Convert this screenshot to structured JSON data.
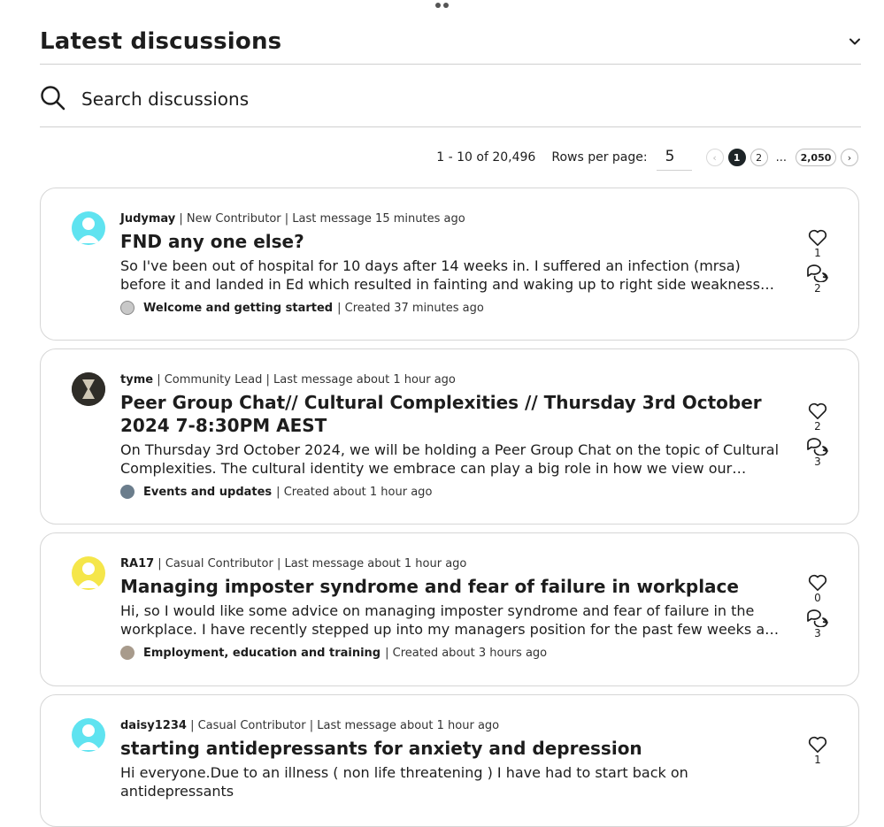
{
  "header": {
    "title": "Latest discussions"
  },
  "search": {
    "placeholder": "Search discussions"
  },
  "pagination": {
    "range": "1 - 10 of 20,496",
    "rows_label": "Rows per page:",
    "rows_value": "5",
    "pages": [
      "1",
      "2"
    ],
    "ellipsis": "...",
    "last_page": "2,050",
    "prev_icon": "‹",
    "next_icon": "›"
  },
  "discussions": [
    {
      "author": "Judymay",
      "role": "New Contributor",
      "last_message": "Last message 15 minutes ago",
      "title": "FND any one else?",
      "excerpt": "So I've been out of hospital for 10 days after 14 weeks in. I suffered an infection (mrsa) before it and landed in Ed which resulted in fainting and waking up to right side weakness and loss of sensation...",
      "board": "Welcome and getting started",
      "created": "Created 37 minutes ago",
      "likes": "1",
      "replies": "2",
      "avatar_color": "#5fe3f0"
    },
    {
      "author": "tyme",
      "role": "Community Lead",
      "last_message": "Last message about 1 hour ago",
      "title": "Peer Group Chat// Cultural Complexities // Thursday 3rd October 2024 7-8:30PM AEST",
      "excerpt": "On Thursday 3rd October 2024, we will be holding a Peer Group Chat on the topic of Cultural Complexities. The cultural identity we embrace can play a big role in how we view our mental health...",
      "board": "Events and updates",
      "created": "Created about 1 hour ago",
      "likes": "2",
      "replies": "3",
      "avatar_color": "#3a3a32"
    },
    {
      "author": "RA17",
      "role": "Casual Contributor",
      "last_message": "Last message about 1 hour ago",
      "title": "Managing imposter syndrome and fear of failure in workplace",
      "excerpt": "Hi, so I would like some advice on managing imposter syndrome and fear of failure in the workplace. I have recently stepped up into my managers position for the past few weeks and I have been...",
      "board": "Employment, education and training",
      "created": "Created about 3 hours ago",
      "likes": "0",
      "replies": "3",
      "avatar_color": "#f5e64a"
    },
    {
      "author": "daisy1234",
      "role": "Casual Contributor",
      "last_message": "Last message about 1 hour ago",
      "title": "starting antidepressants for anxiety and depression",
      "excerpt": "Hi everyone.Due to an illness ( non life threatening ) I have had to start back on antidepressants",
      "board": "",
      "created": "",
      "likes": "1",
      "replies": "",
      "avatar_color": "#5fe3f0"
    }
  ]
}
